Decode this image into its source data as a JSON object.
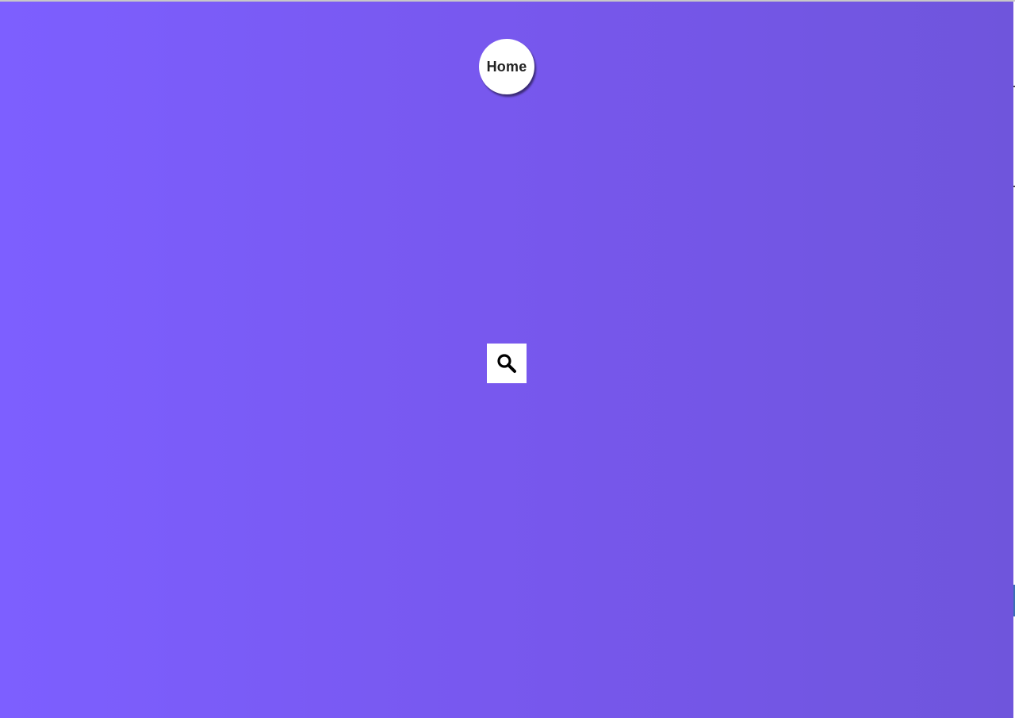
{
  "nav": {
    "home_label": "Home"
  },
  "search": {
    "icon": "search-icon"
  },
  "colors": {
    "background_start": "#7d5fff",
    "background_end": "#6f55dc",
    "button_bg": "#ffffff",
    "text": "#222222"
  }
}
